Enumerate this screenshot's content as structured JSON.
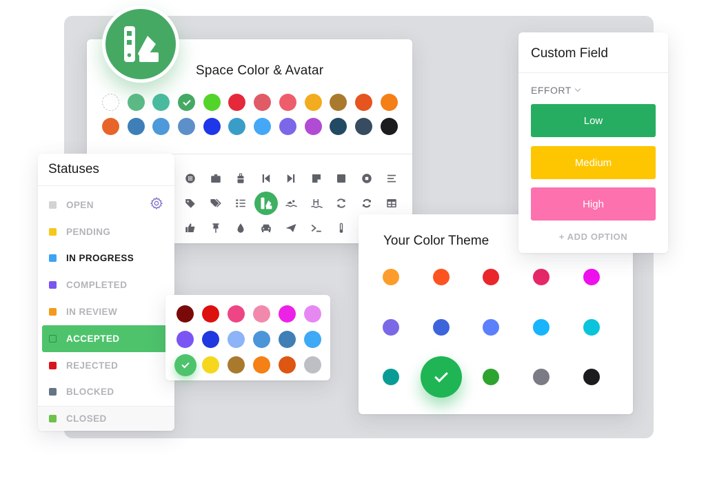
{
  "space_panel": {
    "title": "Space Color & Avatar",
    "avatar_icon": "swatchbook-icon",
    "colors_row1": [
      "none",
      "#5dba86",
      "#4bbba0",
      "#45a964",
      "#52d42a",
      "#e5293a",
      "#e15b66",
      "#ee5d6b",
      "#f3ac1f",
      "#a97a2e",
      "#e6541f",
      "#f47f17"
    ],
    "colors_row2": [
      "#e7652a",
      "#3e7fb8",
      "#4d99da",
      "#5d8fc9",
      "#1e37e8",
      "#3a9dc8",
      "#44a8f6",
      "#7a68e8",
      "#b14bd3",
      "#234a63",
      "#374b61",
      "#1c1c1e"
    ],
    "selected_color_index": 3,
    "icons": [
      "volleyball-icon",
      "briefcase-icon",
      "luggage-icon",
      "skip-back-icon",
      "skip-forward-icon",
      "sticky-note-icon",
      "square-icon",
      "circle-stop-icon",
      "menu-lines-icon",
      "tag-icon",
      "tags-icon",
      "checklist-icon",
      "swatchbook-icon",
      "swimmer-icon",
      "pool-ladder-icon",
      "refresh-icon",
      "sync-icon",
      "table-icon",
      "thumbs-up-icon",
      "pushpin-icon",
      "droplet-icon",
      "car-icon",
      "paper-plane-icon",
      "terminal-icon",
      "thermometer-icon"
    ],
    "selected_icon_index": 12,
    "selected_icon_color": "#3db061"
  },
  "statuses": {
    "title": "Statuses",
    "settings_icon": "gear-icon",
    "items": [
      {
        "label": "OPEN",
        "color": "#d3d3d5",
        "state": "muted"
      },
      {
        "label": "PENDING",
        "color": "#f6c81c",
        "state": "muted"
      },
      {
        "label": "IN PROGRESS",
        "color": "#3ea3f2",
        "state": "strong"
      },
      {
        "label": "COMPLETED",
        "color": "#7b55f2",
        "state": "muted"
      },
      {
        "label": "IN REVIEW",
        "color": "#f39b1a",
        "state": "muted"
      },
      {
        "label": "ACCEPTED",
        "color": "#4ec36c",
        "state": "active"
      },
      {
        "label": "REJECTED",
        "color": "#d9141c",
        "state": "muted"
      },
      {
        "label": "BLOCKED",
        "color": "#657586",
        "state": "muted"
      }
    ],
    "footer": {
      "label": "CLOSED",
      "color": "#6cc24a"
    }
  },
  "mini_picker": {
    "colors": [
      "#7a0a0a",
      "#dd1010",
      "#ee4585",
      "#f289ad",
      "#ec22e6",
      "#e588f2",
      "#7a55f4",
      "#1f38e0",
      "#8db3f8",
      "#4b95d9",
      "#3f7fb5",
      "#3ea9f5",
      "#4ec36c",
      "#f5d71e",
      "#a97a2e",
      "#f48016",
      "#dd5612",
      "#bdbfc4"
    ],
    "selected_index": 12
  },
  "theme_panel": {
    "title": "Your Color Theme",
    "colors": [
      "#fc9c2c",
      "#fc5420",
      "#e9262c",
      "#e52868",
      "#ef10ee",
      "#7b68e7",
      "#3e64dc",
      "#5c80fc",
      "#18b4fc",
      "#0ac4dc",
      "#0a9c94",
      "#1fb555",
      "#2da330",
      "#7b7b85",
      "#1c1c1e"
    ],
    "selected_index": 11
  },
  "custom_field": {
    "title": "Custom Field",
    "field_label": "EFFORT",
    "options": [
      {
        "label": "Low",
        "color": "#27ad61"
      },
      {
        "label": "Medium",
        "color": "#fdc600"
      },
      {
        "label": "High",
        "color": "#fd71ae"
      }
    ],
    "add_option_label": "+ ADD OPTION"
  }
}
